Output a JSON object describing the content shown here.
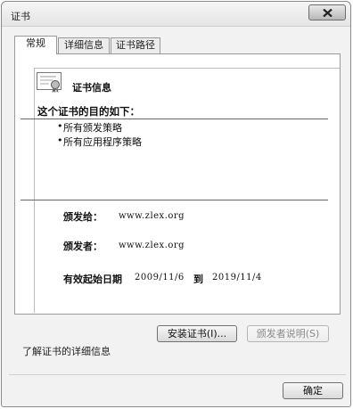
{
  "window": {
    "title": "证书"
  },
  "tabs": [
    {
      "label": "常规"
    },
    {
      "label": "详细信息"
    },
    {
      "label": "证书路径"
    }
  ],
  "cert": {
    "title": "证书信息",
    "purpose_heading": "这个证书的目的如下：",
    "purposes": [
      "所有颁发策略",
      "所有应用程序策略"
    ],
    "issued_to_label": "颁发给：",
    "issued_to_value": "www.zlex.org",
    "issued_by_label": "颁发者：",
    "issued_by_value": "www.zlex.org",
    "validity_label": "有效起始日期",
    "valid_from": "2009/11/6",
    "valid_to_word": "到",
    "valid_to": "2019/11/4"
  },
  "buttons": {
    "install": "安装证书(I)...",
    "issuer_statement": "颁发者说明(S)",
    "ok": "确定"
  },
  "link": {
    "text": "了解证书的详细信息"
  },
  "icons": {
    "close": "close-icon",
    "certificate": "certificate-icon"
  }
}
